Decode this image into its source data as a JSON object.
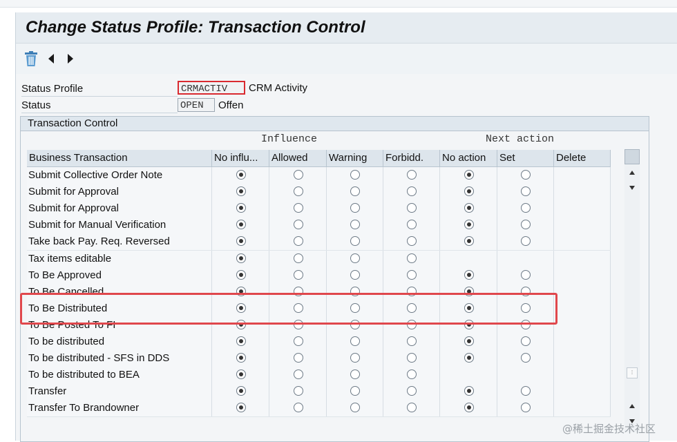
{
  "title": "Change Status Profile: Transaction Control",
  "toolbar": {
    "delete_icon": "trash-icon",
    "prev_icon": "triangle-left-icon",
    "next_icon": "triangle-right-icon"
  },
  "fields": {
    "status_profile": {
      "label": "Status Profile",
      "value": "CRMACTIV",
      "description": "CRM Activity"
    },
    "status": {
      "label": "Status",
      "value": "OPEN",
      "description": "Offen"
    }
  },
  "group": {
    "title": "Transaction Control",
    "influence_header": "Influence",
    "next_action_header": "Next action"
  },
  "columns": [
    "Business Transaction",
    "No influ...",
    "Allowed",
    "Warning",
    "Forbidd.",
    "No action",
    "Set",
    "Delete"
  ],
  "rows": [
    {
      "label": "Submit Collective Order Note",
      "influence": "none",
      "action": "noaction"
    },
    {
      "label": "Submit for Approval",
      "influence": "none",
      "action": "noaction"
    },
    {
      "label": "Submit for Approval",
      "influence": "none",
      "action": "noaction"
    },
    {
      "label": "Submit for Manual Verification",
      "influence": "none",
      "action": "noaction"
    },
    {
      "label": "Take back Pay. Req. Reversed",
      "influence": "none",
      "action": "noaction"
    },
    {
      "label": "Tax items editable",
      "influence": "none",
      "action": null
    },
    {
      "label": "To Be Approved",
      "influence": "none",
      "action": "noaction"
    },
    {
      "label": "To Be Cancelled",
      "influence": "none",
      "action": "noaction"
    },
    {
      "label": "To Be Distributed",
      "influence": "none",
      "action": "noaction"
    },
    {
      "label": "To Be Posted To FI",
      "influence": "none",
      "action": "noaction"
    },
    {
      "label": "To be distributed",
      "influence": "none",
      "action": "noaction"
    },
    {
      "label": "To be distributed - SFS in DDS",
      "influence": "none",
      "action": "noaction"
    },
    {
      "label": "To be distributed to BEA",
      "influence": "none",
      "action": null
    },
    {
      "label": "Transfer",
      "influence": "none",
      "action": "noaction"
    },
    {
      "label": "Transfer To Brandowner",
      "influence": "none",
      "action": "noaction"
    }
  ],
  "highlight_row": "To Be Distributed",
  "colors": {
    "highlight": "#e0474c",
    "accent_box": "#d9292f"
  },
  "watermark": "@稀土掘金技术社区"
}
